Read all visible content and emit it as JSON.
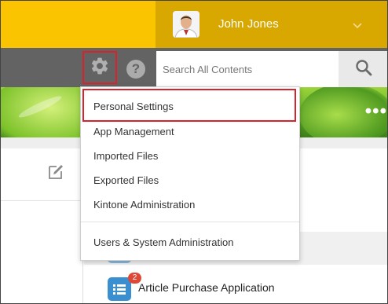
{
  "header": {
    "user_name": "John Jones",
    "colors": {
      "topbar": "#fbc400",
      "user_box": "#d9a800",
      "toolbar": "#636363",
      "highlight": "#d9232c"
    }
  },
  "toolbar": {
    "help_label": "?",
    "search": {
      "placeholder": "Search All Contents"
    }
  },
  "menu": {
    "items": [
      {
        "label": "Personal Settings"
      },
      {
        "label": "App Management"
      },
      {
        "label": "Imported Files"
      },
      {
        "label": "Exported Files"
      },
      {
        "label": "Kintone Administration"
      },
      {
        "label": "Users & System Administration"
      }
    ]
  },
  "apps": [
    {
      "label": "Article Purchase Application",
      "badge": "2"
    }
  ]
}
